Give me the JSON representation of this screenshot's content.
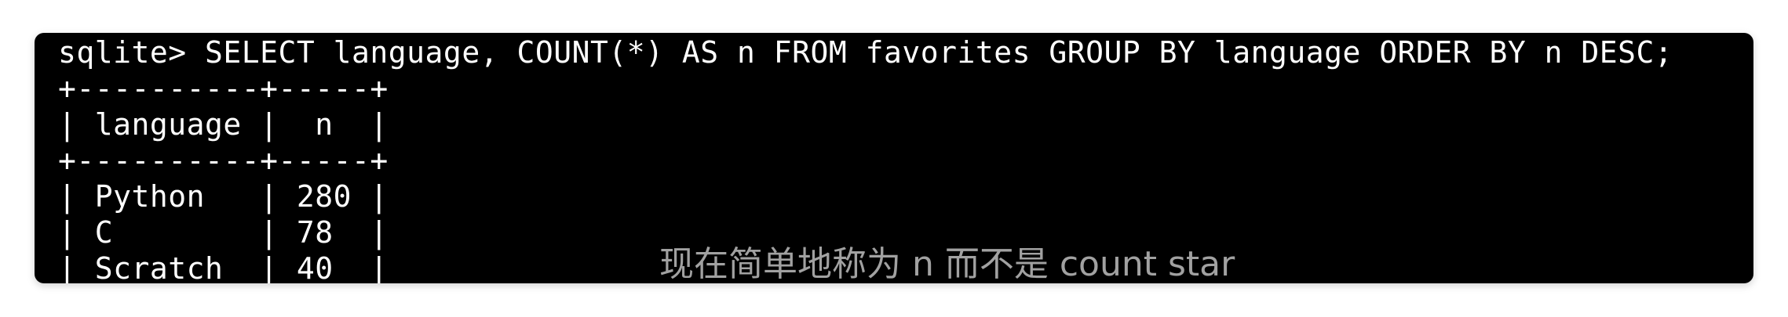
{
  "terminal": {
    "lines": [
      "sqlite> SELECT language, COUNT(*) AS n FROM favorites GROUP BY language ORDER BY n DESC;",
      "+----------+-----+",
      "| language |  n  |",
      "+----------+-----+",
      "| Python   | 280 |",
      "| C        | 78  |",
      "| Scratch  | 40  |"
    ]
  },
  "subtitle": "现在简单地称为 n 而不是 count star"
}
